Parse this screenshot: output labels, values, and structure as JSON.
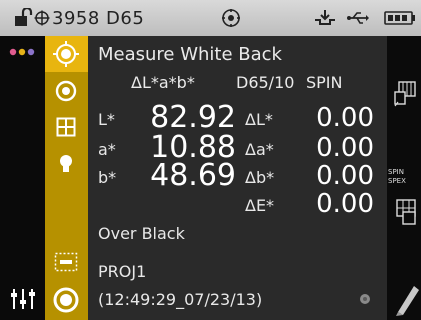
{
  "statusbar": {
    "device_label": "3958 D65"
  },
  "measurement": {
    "title": "Measure White Back",
    "header": {
      "mode": "ΔL*a*b*",
      "illuminant": "D65/10",
      "spin": "SPIN"
    },
    "rows": [
      {
        "label": "L*",
        "value": "82.92",
        "delta_label": "ΔL*",
        "delta_value": "0.00"
      },
      {
        "label": "a*",
        "value": "10.88",
        "delta_label": "Δa*",
        "delta_value": "0.00"
      },
      {
        "label": "b*",
        "value": "48.69",
        "delta_label": "Δb*",
        "delta_value": "0.00"
      }
    ],
    "delta_e_label": "ΔE*",
    "delta_e_value": "0.00",
    "background": "Over Black",
    "project": "PROJ1",
    "timestamp": "(12:49:29_07/23/13)"
  },
  "right_panel": {
    "spin_label_1": "SPIN",
    "spin_label_2": "SPEX"
  },
  "colors": {
    "accent": "#b69100",
    "accent_active": "#e8b50f",
    "panel": "#2a2a2a"
  }
}
